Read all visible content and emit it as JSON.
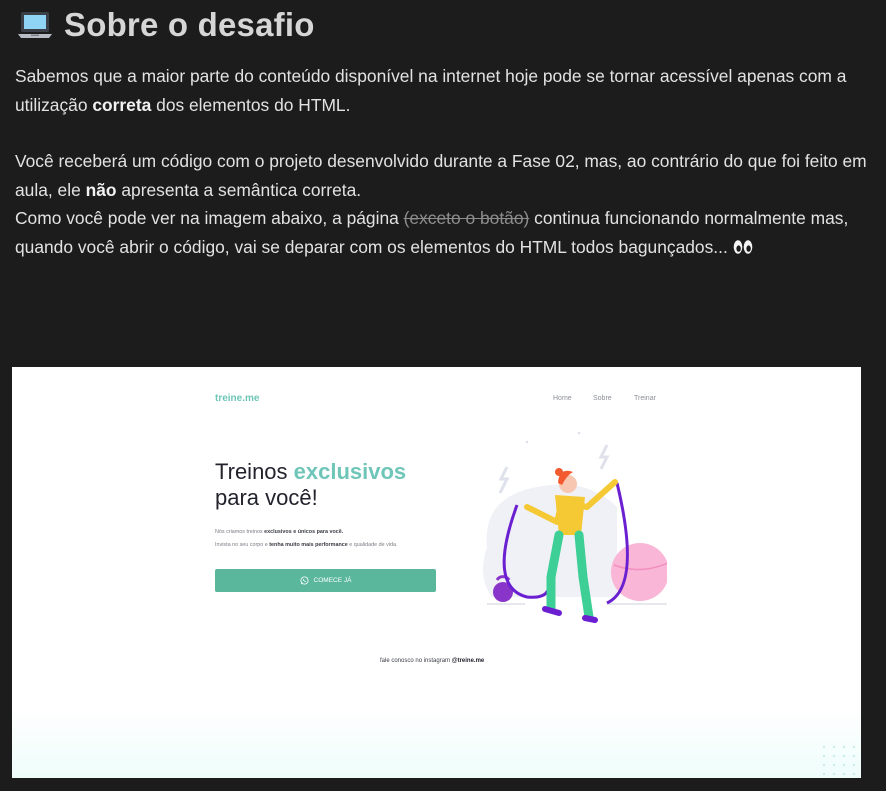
{
  "section": {
    "icon": "laptop-icon",
    "title": "Sobre o desafio"
  },
  "paragraphs": {
    "p1_a": "Sabemos que a maior parte do conteúdo disponível na internet hoje pode se tornar acessível apenas com a utilização ",
    "p1_bold": "correta",
    "p1_b": " dos elementos do HTML.",
    "p2_a": "Você receberá um código com o projeto desenvolvido durante a Fase 02, mas, ao contrário do que foi feito em aula, ele ",
    "p2_bold": "não",
    "p2_b": " apresenta a semântica correta.",
    "p3_a": "Como você pode ver na imagem abaixo, a página ",
    "p3_strike": "(exceto o botão)",
    "p3_b": " continua funcionando normalmente mas, quando você abrir o código, vai se deparar com os elementos do HTML todos bagunçados... ",
    "p3_emoji": "eyes-icon"
  },
  "preview": {
    "logo": "treine.me",
    "nav": [
      "Home",
      "Sobre",
      "Treinar"
    ],
    "hero_line1_a": "Treinos ",
    "hero_accent": "exclusivos",
    "hero_line2": "para você!",
    "sub1_a": "Nós criamos treinos ",
    "sub1_bold": "exclusivos e únicos para você.",
    "sub2_a": "Invista no seu corpo e ",
    "sub2_bold": "tenha muito mais performance",
    "sub2_b": " e qualidade de vida.",
    "cta_label": "COMECE JÁ",
    "cta_icon": "whatsapp-icon",
    "footer_a": "fale conosco no instagram ",
    "footer_bold": "@treine.me",
    "colors": {
      "accent": "#6fc6b8",
      "button": "#5ab79b",
      "page_bg": "#1c1c1d"
    }
  }
}
